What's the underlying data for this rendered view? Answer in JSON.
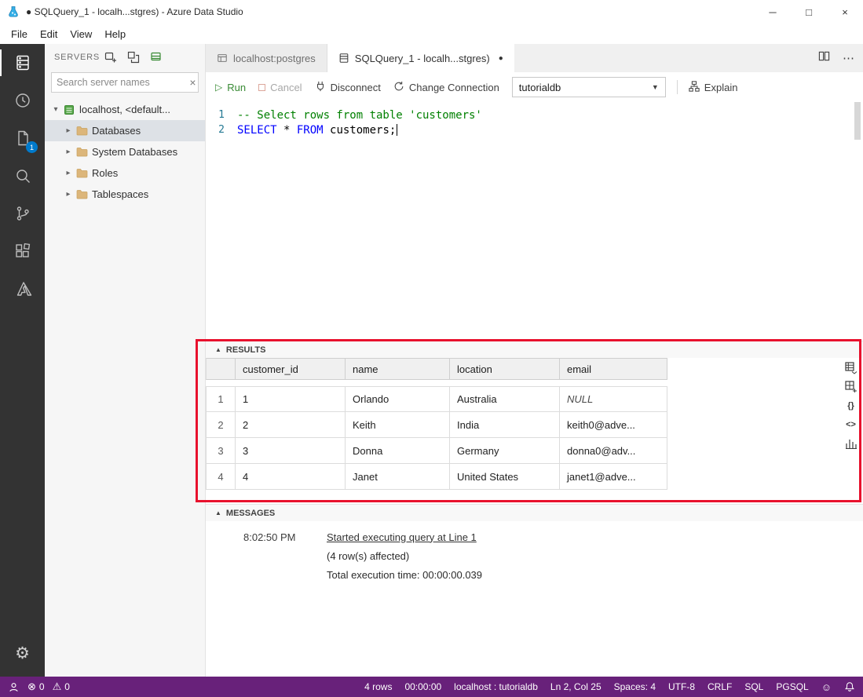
{
  "titlebar": {
    "title": "● SQLQuery_1 - localh...stgres) - Azure Data Studio"
  },
  "menubar": {
    "items": [
      "File",
      "Edit",
      "View",
      "Help"
    ]
  },
  "activity_bar": {
    "open_editors_badge": "1"
  },
  "sidebar": {
    "title": "SERVERS",
    "search_placeholder": "Search server names",
    "tree": {
      "server_label": "localhost, <default...",
      "folders": [
        "Databases",
        "System Databases",
        "Roles",
        "Tablespaces"
      ]
    }
  },
  "tabs": {
    "inactive": "localhost:postgres",
    "active": "SQLQuery_1 - localh...stgres)"
  },
  "toolbar": {
    "run": "Run",
    "cancel": "Cancel",
    "disconnect": "Disconnect",
    "change_connection": "Change Connection",
    "database": "tutorialdb",
    "explain": "Explain"
  },
  "editor": {
    "line1_num": "1",
    "line2_num": "2",
    "line1_comment": "-- Select rows from table 'customers'",
    "line2_kw1": "SELECT",
    "line2_mid": " * ",
    "line2_kw2": "FROM",
    "line2_tail": " customers;"
  },
  "results": {
    "title": "RESULTS",
    "columns": [
      "customer_id",
      "name",
      "location",
      "email"
    ],
    "rows": [
      [
        "1",
        "1",
        "Orlando",
        "Australia",
        "NULL"
      ],
      [
        "2",
        "2",
        "Keith",
        "India",
        "keith0@adve..."
      ],
      [
        "3",
        "3",
        "Donna",
        "Germany",
        "donna0@adv..."
      ],
      [
        "4",
        "4",
        "Janet",
        "United States",
        "janet1@adve..."
      ]
    ]
  },
  "messages": {
    "title": "MESSAGES",
    "timestamp": "8:02:50 PM",
    "link": "Started executing query at Line 1",
    "rows_affected": "(4 row(s) affected)",
    "execution_time": "Total execution time: 00:00:00.039"
  },
  "statusbar": {
    "errors": "0",
    "warnings": "0",
    "row_count": "4 rows",
    "elapsed": "00:00:00",
    "connection": "localhost : tutorialdb",
    "cursor": "Ln 2, Col 25",
    "indent": "Spaces: 4",
    "encoding": "UTF-8",
    "eol": "CRLF",
    "language": "SQL",
    "provider": "PGSQL"
  },
  "icons": {
    "twisty": "▲",
    "expanded_caret": "▾",
    "collapsed_caret": "▸",
    "dropdown_caret": "▼",
    "overflow": "⋯",
    "dirty_dot": "●",
    "run": "▷",
    "smiley": "☺",
    "error": "⊗",
    "warning": "⚠",
    "gear": "⚙",
    "clear": "×",
    "minimize": "─",
    "maximize": "□",
    "close": "×",
    "json": "{}",
    "xml": "<>"
  },
  "colors": {
    "statusbar_bg": "#68217a",
    "annotation": "#e8112d",
    "keyword": "#0000ff",
    "comment": "#008000"
  }
}
